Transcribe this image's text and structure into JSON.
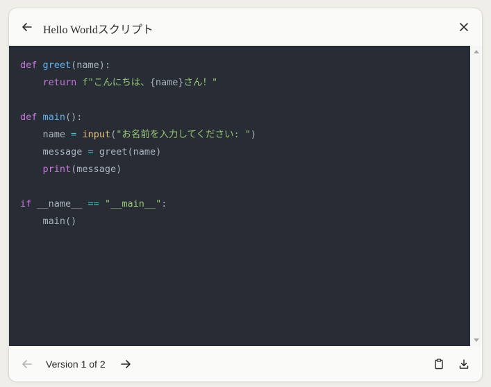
{
  "header": {
    "title": "Hello Worldスクリプト",
    "back_icon": "arrow-left-icon",
    "close_icon": "close-icon"
  },
  "code": {
    "lines": [
      [
        {
          "t": "def",
          "c": "kw"
        },
        {
          "t": " "
        },
        {
          "t": "greet",
          "c": "fn"
        },
        {
          "t": "(name):"
        }
      ],
      [
        {
          "t": "    "
        },
        {
          "t": "return",
          "c": "kw"
        },
        {
          "t": " "
        },
        {
          "t": "f\"こんにちは、",
          "c": "str"
        },
        {
          "t": "{name}"
        },
        {
          "t": "さん！\"",
          "c": "str"
        }
      ],
      [],
      [
        {
          "t": "def",
          "c": "kw"
        },
        {
          "t": " "
        },
        {
          "t": "main",
          "c": "fn"
        },
        {
          "t": "():"
        }
      ],
      [
        {
          "t": "    name "
        },
        {
          "t": "=",
          "c": "op"
        },
        {
          "t": " "
        },
        {
          "t": "input",
          "c": "bi"
        },
        {
          "t": "("
        },
        {
          "t": "\"お名前を入力してください: \"",
          "c": "str"
        },
        {
          "t": ")"
        }
      ],
      [
        {
          "t": "    message "
        },
        {
          "t": "=",
          "c": "op"
        },
        {
          "t": " greet(name)"
        }
      ],
      [
        {
          "t": "    "
        },
        {
          "t": "print",
          "c": "kw"
        },
        {
          "t": "(message)"
        }
      ],
      [],
      [
        {
          "t": "if",
          "c": "kw"
        },
        {
          "t": " __name__ "
        },
        {
          "t": "==",
          "c": "op"
        },
        {
          "t": " "
        },
        {
          "t": "\"__main__\"",
          "c": "str"
        },
        {
          "t": ":"
        }
      ],
      [
        {
          "t": "    main()"
        }
      ]
    ]
  },
  "footer": {
    "version_label": "Version 1 of 2",
    "prev_icon": "arrow-left-icon",
    "next_icon": "arrow-right-icon",
    "copy_icon": "clipboard-icon",
    "download_icon": "download-icon"
  },
  "colors": {
    "code_background": "#282c34",
    "keyword": "#c678dd",
    "function": "#61afef",
    "string": "#98c379",
    "operator": "#56b6c2",
    "builtin": "#e5c07b",
    "default_text": "#abb2bf"
  }
}
